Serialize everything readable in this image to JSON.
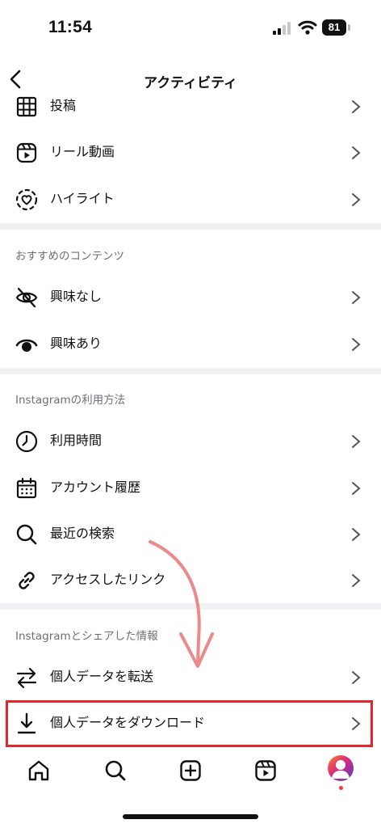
{
  "status_bar": {
    "time": "11:54",
    "battery_level": "81"
  },
  "header": {
    "title": "アクティビティ"
  },
  "rows_top": [
    {
      "label": "投稿",
      "icon": "grid-icon"
    },
    {
      "label": "リール動画",
      "icon": "reels-icon"
    },
    {
      "label": "ハイライト",
      "icon": "highlight-icon"
    }
  ],
  "section_recommended": {
    "title": "おすすめのコンテンツ",
    "rows": [
      {
        "label": "興味なし",
        "icon": "eye-off-icon"
      },
      {
        "label": "興味あり",
        "icon": "eye-icon"
      }
    ]
  },
  "section_usage": {
    "title": "Instagramの利用方法",
    "rows": [
      {
        "label": "利用時間",
        "icon": "clock-icon"
      },
      {
        "label": "アカウント履歴",
        "icon": "calendar-icon"
      },
      {
        "label": "最近の検索",
        "icon": "search-icon"
      },
      {
        "label": "アクセスしたリンク",
        "icon": "link-icon"
      }
    ]
  },
  "section_shared": {
    "title": "Instagramとシェアした情報",
    "rows": [
      {
        "label": "個人データを転送",
        "icon": "transfer-icon"
      },
      {
        "label": "個人データをダウンロード",
        "icon": "download-icon"
      }
    ]
  },
  "tab_bar": {
    "tabs": [
      "home-icon",
      "search-icon",
      "create-icon",
      "reels-icon",
      "profile-avatar"
    ]
  },
  "colors": {
    "highlight": "#e3262c",
    "annotation_arrow": "#ec8a8a",
    "divider": "#f1f1f3"
  }
}
